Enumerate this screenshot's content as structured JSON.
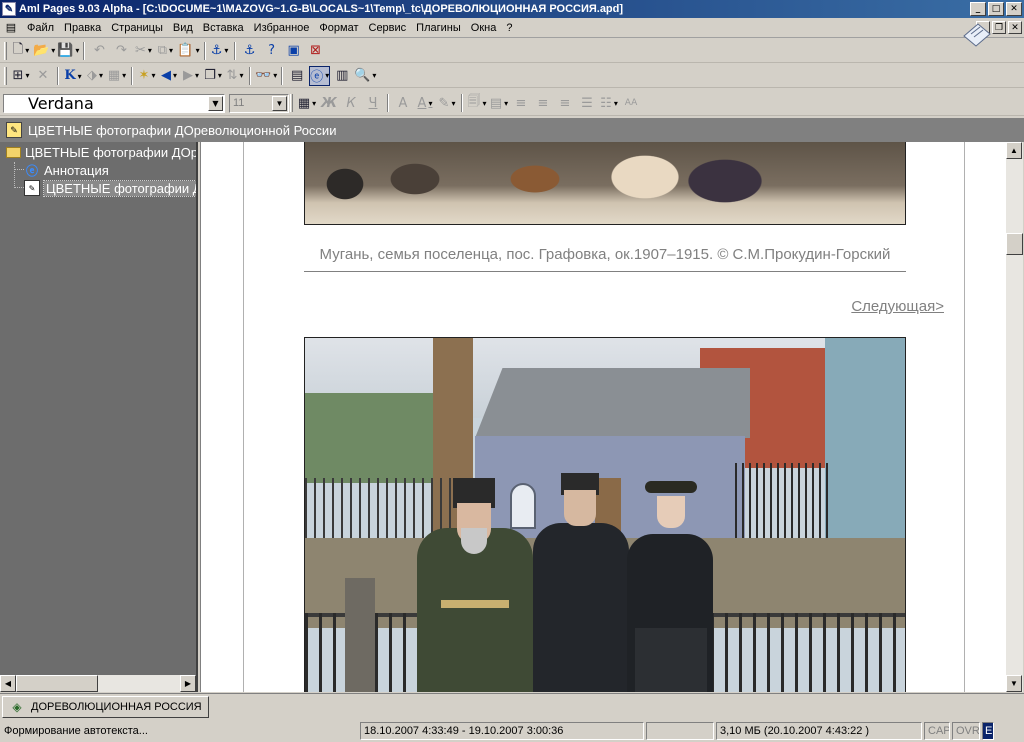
{
  "window": {
    "title": "Aml Pages 9.03 Alpha - [C:\\DOCUME~1\\MAZOVG~1.G-B\\LOCALS~1\\Temp\\_tc\\ДОРЕВОЛЮЦИОННАЯ РОССИЯ.apd]",
    "minimize_glyph": "_",
    "maximize_glyph": "□",
    "close_glyph": "✕",
    "restore_glyph": "❐"
  },
  "menu": {
    "items": [
      "Файл",
      "Правка",
      "Страницы",
      "Вид",
      "Вставка",
      "Избранное",
      "Формат",
      "Сервис",
      "Плагины",
      "Окна",
      "?"
    ]
  },
  "format_toolbar": {
    "font_name": "Verdana",
    "font_size": "11",
    "bold_label": "Ж",
    "italic_label": "К",
    "font_color_label": "A",
    "highlight_label": "A",
    "small_caps_label": "AA"
  },
  "toolbar2": {
    "bold_k_label": "K"
  },
  "panel": {
    "header_title": "ЦВЕТНЫЕ фотографии ДОреволюционной России"
  },
  "tree": {
    "root_label": "ЦВЕТНЫЕ фотографии ДОреволюционной России",
    "items": [
      {
        "label": "Аннотация",
        "icon": "ie-icon"
      },
      {
        "label": "ЦВЕТНЫЕ фотографии ДОреволюционной России",
        "icon": "page-icon"
      }
    ]
  },
  "content": {
    "caption": "Мугань, семья поселенца, пос. Графовка, ок.1907–1915. © С.М.Прокудин-Горский",
    "next_link": "Следующая>"
  },
  "tabs": {
    "document_tab": "ДОРЕВОЛЮЦИОННАЯ РОССИЯ"
  },
  "status": {
    "message": "Формирование автотекста...",
    "dates": "18.10.2007 4:33:49  - 19.10.2007 3:00:36",
    "size": "3,10 МБ (20.10.2007 4:43:22  )",
    "cap": "CAP",
    "ovr": "OVR",
    "mode": "E"
  }
}
